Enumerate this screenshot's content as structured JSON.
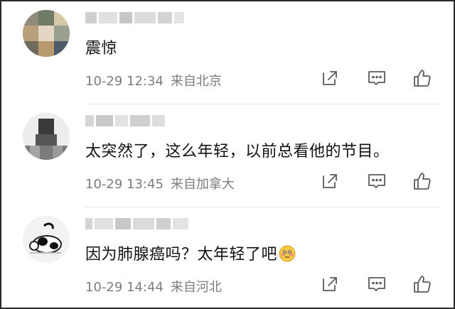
{
  "comments": [
    {
      "text": "震惊",
      "time": "10-29 12:34",
      "location": "来自北京"
    },
    {
      "text": "太突然了，这么年轻，以前总看他的节目。",
      "time": "10-29 13:45",
      "location": "来自加拿大"
    },
    {
      "text": "因为肺腺癌吗？太年轻了吧",
      "time": "10-29 14:44",
      "location": "来自河北"
    }
  ],
  "icons": {
    "share": "share-icon",
    "reply": "comment-icon",
    "like": "thumbs-up-icon",
    "emoji": "flushed-face-emoji"
  },
  "colors": {
    "text": "#111111",
    "meta": "#7d7d7d",
    "icon": "#5a5a5a",
    "divider": "#e6e6e6"
  }
}
